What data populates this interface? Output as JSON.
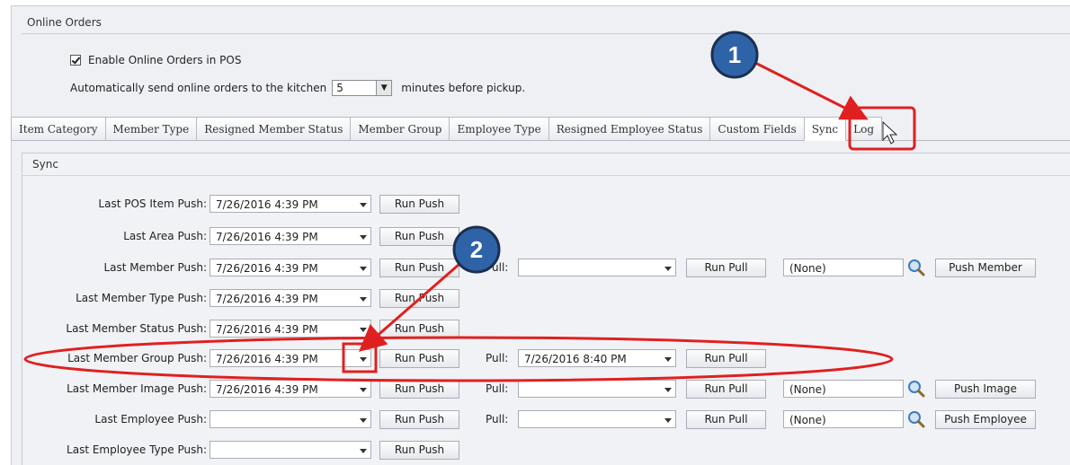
{
  "header": {
    "title": "Online Orders"
  },
  "options": {
    "enable_label": "Enable Online Orders in POS",
    "auto_prefix": "Automatically send online orders to the kitchen",
    "minutes_value": "5",
    "auto_suffix": "minutes before pickup."
  },
  "tabs": [
    {
      "label": "Item Category"
    },
    {
      "label": "Member Type"
    },
    {
      "label": "Resigned Member Status"
    },
    {
      "label": "Member Group"
    },
    {
      "label": "Employee Type"
    },
    {
      "label": "Resigned Employee Status"
    },
    {
      "label": "Custom Fields"
    },
    {
      "label": "Sync"
    },
    {
      "label": "Log"
    }
  ],
  "sync": {
    "title": "Sync",
    "run_push": "Run Push",
    "run_pull": "Run Pull",
    "pull_label": "Pull:",
    "rows": [
      {
        "label": "Last POS Item Push:",
        "date": "7/26/2016 4:39 PM"
      },
      {
        "label": "Last Area Push:",
        "date": "7/26/2016 4:39 PM"
      },
      {
        "label": "Last Member Push:",
        "date": "7/26/2016 4:39 PM",
        "pull": "",
        "search": "(None)",
        "action": "Push Member"
      },
      {
        "label": "Last Member Type Push:",
        "date": "7/26/2016 4:39 PM"
      },
      {
        "label": "Last Member Status Push:",
        "date": "7/26/2016 4:39 PM"
      },
      {
        "label": "Last Member Group Push:",
        "date": "7/26/2016 4:39 PM",
        "pull": "7/26/2016 8:40 PM"
      },
      {
        "label": "Last Member Image Push:",
        "date": "7/26/2016 4:39 PM",
        "pull": "",
        "search": "(None)",
        "action": "Push Image"
      },
      {
        "label": "Last Employee Push:",
        "date": "",
        "pull": "",
        "search": "(None)",
        "action": "Push Employee"
      },
      {
        "label": "Last Employee Type Push:",
        "date": ""
      }
    ]
  },
  "callouts": [
    {
      "number": "1"
    },
    {
      "number": "2"
    }
  ],
  "colors": {
    "callout_red": "#e02020",
    "badge_blue": "#2f63a8"
  }
}
